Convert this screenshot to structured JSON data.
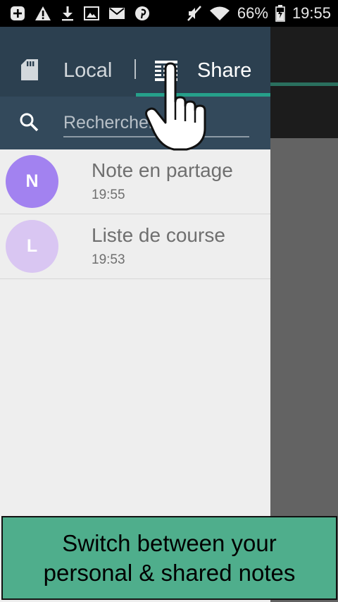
{
  "status_bar": {
    "battery": "66%",
    "time": "19:55",
    "left_icons": [
      "add-box-icon",
      "warning-icon",
      "download-icon",
      "image-icon",
      "mail-icon",
      "pinterest-icon"
    ],
    "right_icons": [
      "volume-muted-icon",
      "wifi-icon",
      "battery-icon"
    ]
  },
  "drawer": {
    "tabs": [
      {
        "label": "Local",
        "icon": "sd-card-icon",
        "selected": false
      },
      {
        "label": "Share",
        "icon": "shared-list-icon",
        "selected": true
      }
    ],
    "search": {
      "placeholder": "Rechercher",
      "value": ""
    },
    "notes": [
      {
        "initial": "N",
        "title": "Note en partage",
        "time": "19:55",
        "avatar_color": "#a282f0"
      },
      {
        "initial": "L",
        "title": "Liste de course",
        "time": "19:53",
        "avatar_color": "#d9c6f2"
      }
    ]
  },
  "caption": {
    "line1": "Switch between your",
    "line2": "personal & shared notes"
  },
  "colors": {
    "header": "#2c4050",
    "search_bar": "#33495b",
    "accent": "#26a08a",
    "caption_bg": "#4fae8c"
  }
}
